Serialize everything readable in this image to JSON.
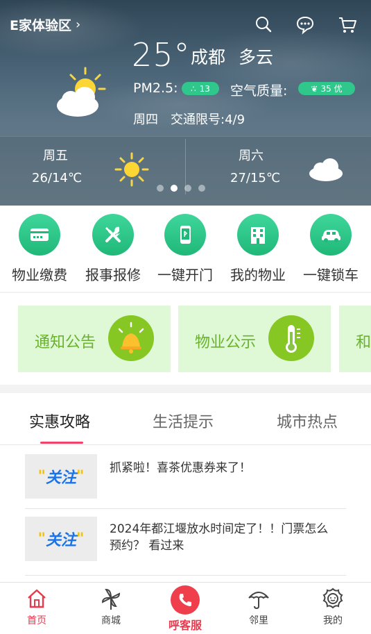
{
  "header": {
    "region": "E家体验区",
    "chevron": "›",
    "icons": [
      "search-icon",
      "message-icon",
      "cart-icon"
    ]
  },
  "weather": {
    "temperature": "25°",
    "city": "成都",
    "condition": "多云",
    "pm_label": "PM2.5:",
    "pm_value": "13",
    "aq_label": "空气质量:",
    "aq_value": "35 优",
    "weekday": "周四",
    "traffic": "交通限号:4/9",
    "forecast": [
      {
        "day": "周五",
        "temp": "26/14℃",
        "icon": "sun-icon"
      },
      {
        "day": "周六",
        "temp": "27/15℃",
        "icon": "cloud-icon"
      }
    ],
    "carousel_active_index": 1,
    "carousel_count": 4
  },
  "quick_actions": [
    {
      "label": "物业缴费",
      "icon": "payment-card-icon"
    },
    {
      "label": "报事报修",
      "icon": "tools-icon"
    },
    {
      "label": "一键开门",
      "icon": "phone-unlock-icon"
    },
    {
      "label": "我的物业",
      "icon": "building-icon"
    },
    {
      "label": "一键锁车",
      "icon": "car-icon"
    }
  ],
  "cards": [
    {
      "label": "通知公告",
      "icon": "bell-icon"
    },
    {
      "label": "物业公示",
      "icon": "thermometer-icon"
    },
    {
      "label": "和",
      "icon": ""
    }
  ],
  "tabs": [
    {
      "label": "实惠攻略",
      "active": true
    },
    {
      "label": "生活提示",
      "active": false
    },
    {
      "label": "城市热点",
      "active": false
    }
  ],
  "news": [
    {
      "thumb": "关注",
      "title_line1": "抓紧啦！喜茶优惠券来了！",
      "title_line2": ""
    },
    {
      "thumb": "关注",
      "title_line1": "2024年都江堰放水时间定了！！门票怎么",
      "title_line2": "预约？ 看过来"
    }
  ],
  "bottom_nav": [
    {
      "label": "首页",
      "icon": "home-icon",
      "active": true
    },
    {
      "label": "商城",
      "icon": "pinwheel-icon",
      "active": false
    },
    {
      "label": "呼客服",
      "icon": "phone-icon",
      "active": false
    },
    {
      "label": "邻里",
      "icon": "umbrella-icon",
      "active": false
    },
    {
      "label": "我的",
      "icon": "flower-face-icon",
      "active": false
    }
  ],
  "colors": {
    "accent_green": "#2fc78b",
    "card_bg": "#dff8d6",
    "card_text": "#6ab22e",
    "tab_indicator": "#f0436a",
    "nav_active": "#e8394d"
  }
}
